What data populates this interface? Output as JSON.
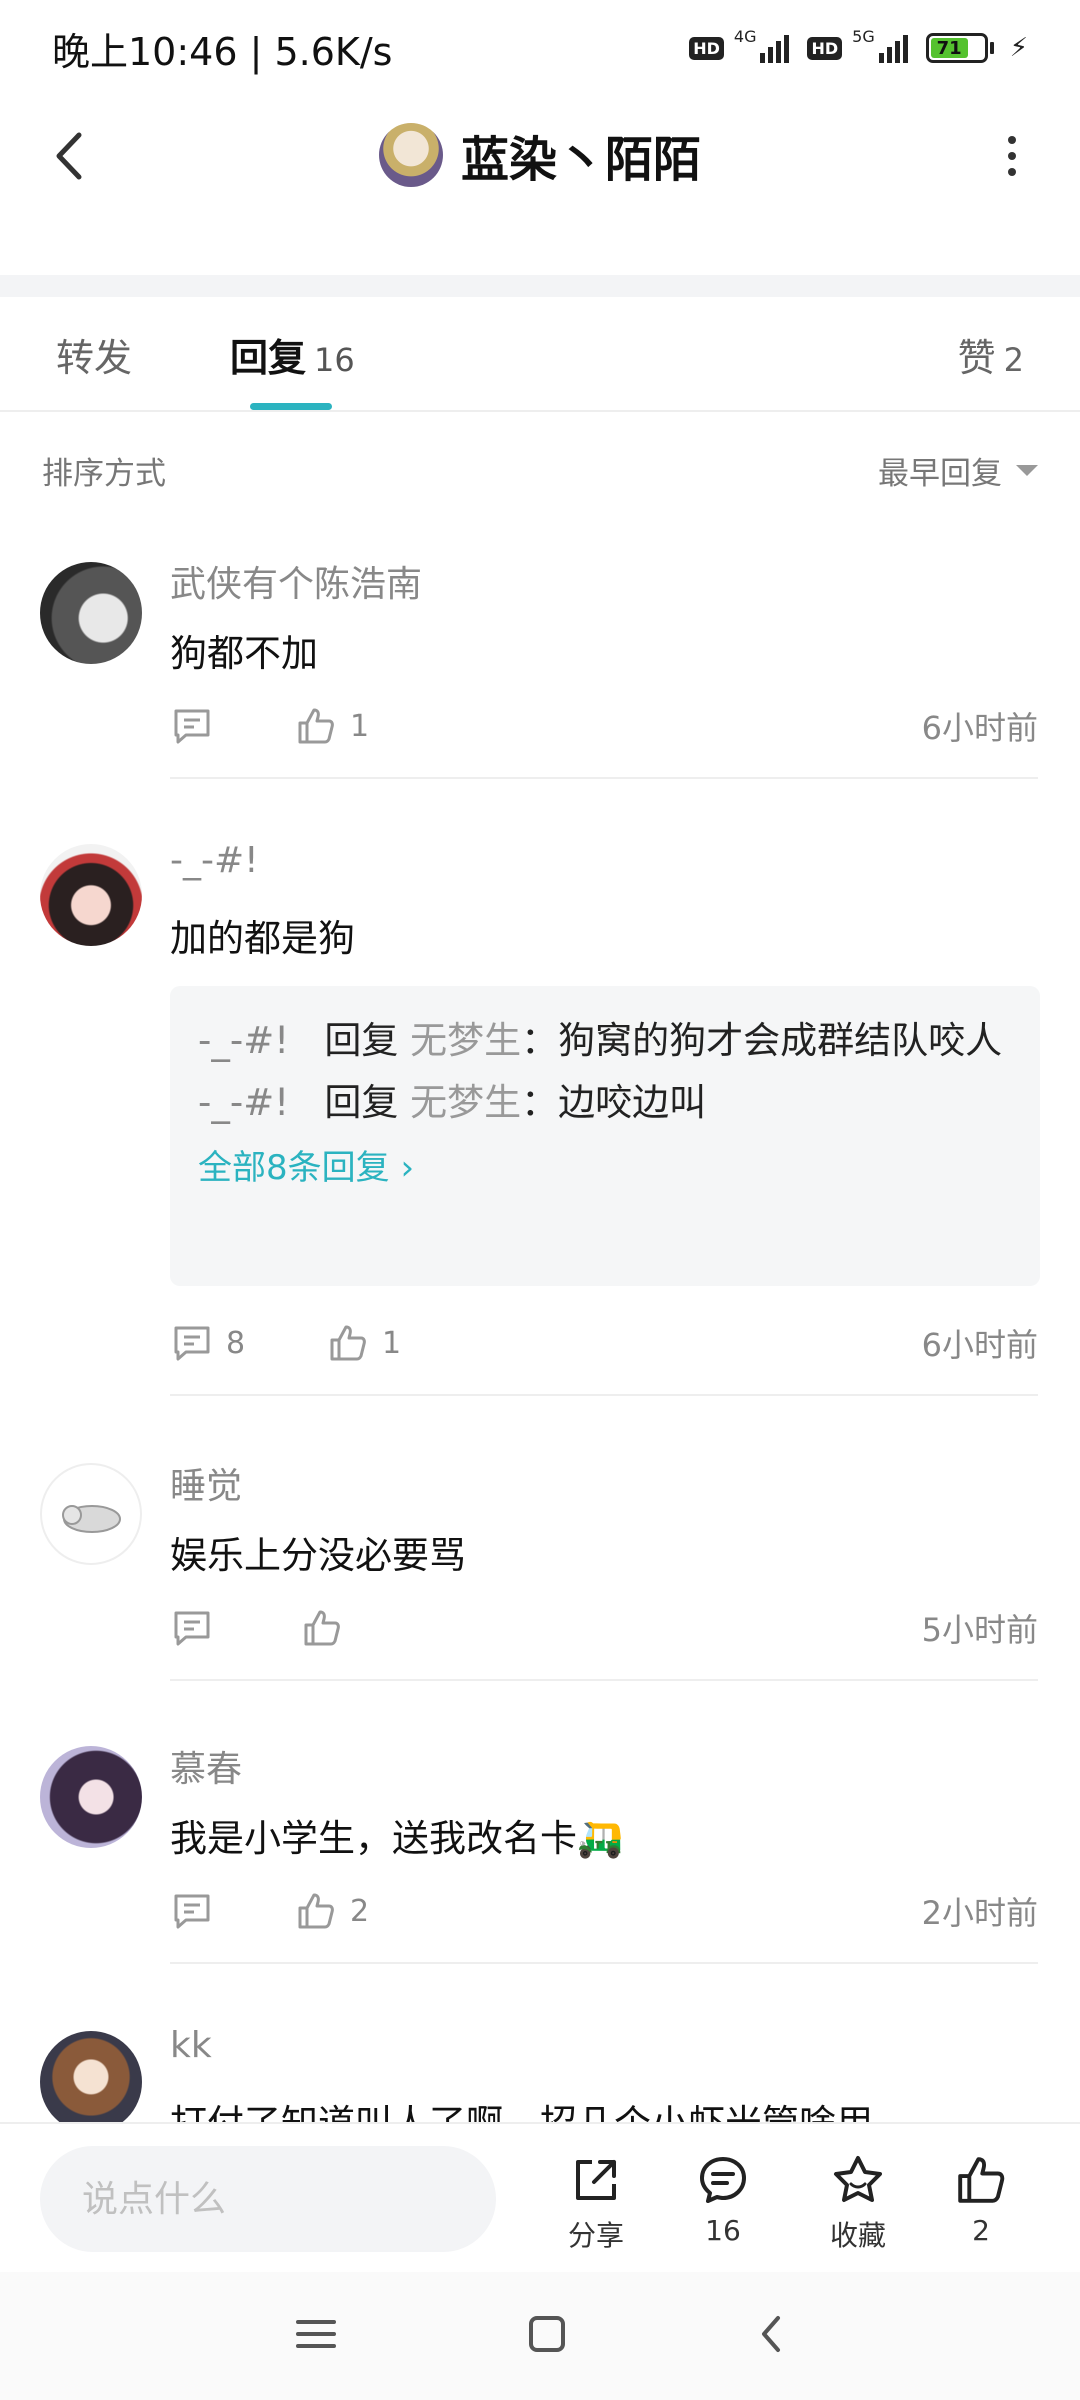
{
  "status_bar": {
    "time_speed": "晚上10:46 | 5.6K/s",
    "hd1": "HD",
    "net1": "4G",
    "hd2": "HD",
    "net2": "5G",
    "battery": "71"
  },
  "header": {
    "title": "蓝染丶陌陌"
  },
  "tabs": {
    "repost": "转发",
    "reply": "回复",
    "reply_count": "16",
    "like": "赞",
    "like_count": "2"
  },
  "sort": {
    "label": "排序方式",
    "value": "最早回复"
  },
  "comments": [
    {
      "name": "武侠有个陈浩南",
      "text": "狗都不加",
      "reply_count": "",
      "likes": "1",
      "time": "6小时前"
    },
    {
      "name": "-_-#!",
      "text": "加的都是狗",
      "replies": [
        {
          "user": "-_-#!",
          "verb": "回复",
          "target": "无梦生",
          "sep": "：",
          "text": "狗窝的狗才会成群结队咬人"
        },
        {
          "user": "-_-#!",
          "verb": "回复",
          "target": "无梦生",
          "sep": "：",
          "text": "边咬边叫"
        }
      ],
      "more": "全部8条回复 ›",
      "reply_count": "8",
      "likes": "1",
      "time": "6小时前"
    },
    {
      "name": "睡觉",
      "text": "娱乐上分没必要骂",
      "reply_count": "",
      "likes": "",
      "time": "5小时前"
    },
    {
      "name": "慕春",
      "text": "我是小学生，送我改名卡🛺",
      "reply_count": "",
      "likes": "2",
      "time": "2小时前"
    },
    {
      "name": "kk",
      "text": "打付了知道叫人了啊，招几个小虾米管啥用"
    }
  ],
  "bottom_bar": {
    "placeholder": "说点什么",
    "share": "分享",
    "comments": "16",
    "favorite": "收藏",
    "likes": "2"
  },
  "colors": {
    "accent": "#2bb3c0",
    "battery": "#55c22f"
  }
}
